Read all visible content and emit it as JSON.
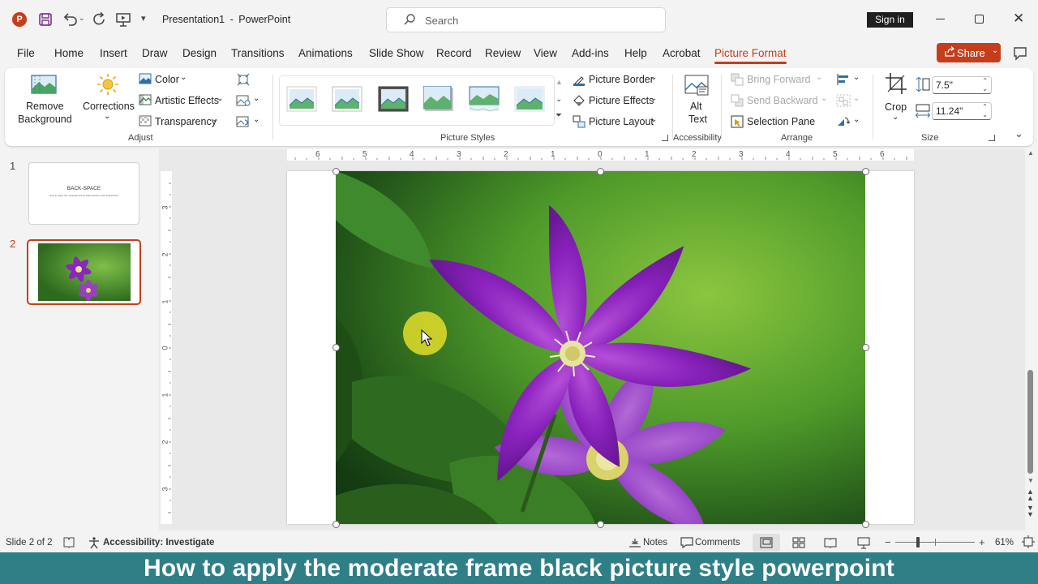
{
  "titlebar": {
    "filename": "Presentation1",
    "separator": "-",
    "app": "PowerPoint",
    "search_placeholder": "Search",
    "sign_in": "Sign in"
  },
  "tabs": [
    "File",
    "Home",
    "Insert",
    "Draw",
    "Design",
    "Transitions",
    "Animations",
    "Slide Show",
    "Record",
    "Review",
    "View",
    "Add-ins",
    "Help",
    "Acrobat",
    "Picture Format"
  ],
  "active_tab": "Picture Format",
  "share_label": "Share",
  "ribbon": {
    "adjust": {
      "remove_bg_line1": "Remove",
      "remove_bg_line2": "Background",
      "corrections": "Corrections",
      "color": "Color",
      "artistic_effects": "Artistic Effects",
      "transparency": "Transparency",
      "group_label": "Adjust"
    },
    "picture_styles": {
      "group_label": "Picture Styles",
      "picture_border": "Picture Border",
      "picture_effects": "Picture Effects",
      "picture_layout": "Picture Layout"
    },
    "accessibility": {
      "alt_line1": "Alt",
      "alt_line2": "Text",
      "group_label": "Accessibility"
    },
    "arrange": {
      "bring_forward": "Bring Forward",
      "send_backward": "Send Backward",
      "selection_pane": "Selection Pane",
      "group_label": "Arrange"
    },
    "size": {
      "crop": "Crop",
      "height": "7.5\"",
      "width": "11.24\"",
      "group_label": "Size"
    }
  },
  "ruler": {
    "h_labels": [
      "6",
      "5",
      "4",
      "3",
      "2",
      "1",
      "0",
      "1",
      "2",
      "3",
      "4",
      "5",
      "6"
    ],
    "v_labels": [
      "3",
      "2",
      "1",
      "0",
      "1",
      "2",
      "3"
    ]
  },
  "slides": [
    {
      "number": "1",
      "title": "BACK-SPACE",
      "subtitle": "How to apply the moderate frame black picture style PowerPoint"
    },
    {
      "number": "2"
    }
  ],
  "statusbar": {
    "slide_info": "Slide 2 of 2",
    "accessibility": "Accessibility: Investigate",
    "notes": "Notes",
    "comments": "Comments",
    "zoom": "61%",
    "zoom_minus": "−",
    "zoom_plus": "+"
  },
  "banner": "How to apply the moderate frame black picture style powerpoint",
  "colors": {
    "accent": "#c43e1c",
    "share": "#c43e1c",
    "banner": "#2f7f87"
  }
}
